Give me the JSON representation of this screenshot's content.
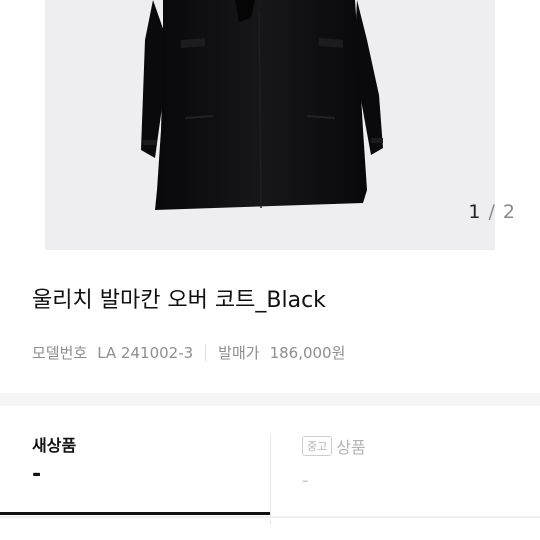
{
  "gallery": {
    "current": "1",
    "separator": "/",
    "total": "2"
  },
  "product": {
    "title": "울리치 발마칸 오버 코트_Black",
    "model_label": "모델번호",
    "model_value": "LA 241002-3",
    "price_label": "발매가",
    "price_value": "186,000원"
  },
  "condition_tabs": {
    "new": {
      "label": "새상품",
      "value": "-"
    },
    "used": {
      "badge": "중고",
      "label": "상품",
      "value": "-"
    }
  },
  "colors": {
    "coat": "#0d0d0f",
    "photo_bg": "#eeedf0",
    "accent": "#111111"
  }
}
